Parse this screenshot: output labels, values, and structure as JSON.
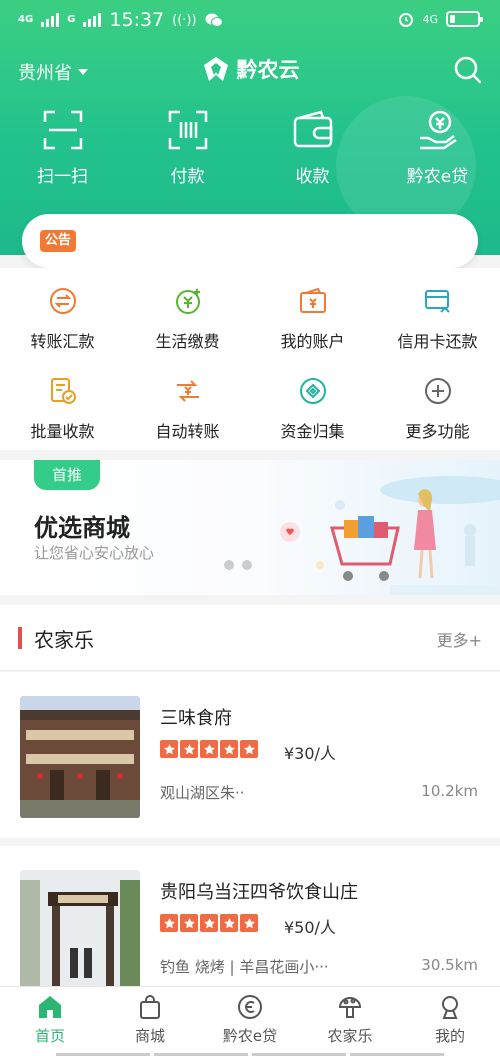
{
  "status_bar": {
    "time": "15:37",
    "network_left": "4G",
    "network_left2": "G",
    "network_right": "4G",
    "battery_level": 0.2
  },
  "header": {
    "province": "贵州省",
    "app_name": "黔农云"
  },
  "quick_actions": [
    {
      "label": "扫一扫",
      "icon": "scan-icon"
    },
    {
      "label": "付款",
      "icon": "barcode-icon"
    },
    {
      "label": "收款",
      "icon": "wallet-icon"
    },
    {
      "label": "黔农e贷",
      "icon": "loan-hand-icon"
    }
  ],
  "notice": {
    "tag": "公告",
    "text": ""
  },
  "services": [
    {
      "label": "转账汇款",
      "icon": "transfer-icon"
    },
    {
      "label": "生活缴费",
      "icon": "bill-payment-icon"
    },
    {
      "label": "我的账户",
      "icon": "account-icon"
    },
    {
      "label": "信用卡还款",
      "icon": "credit-card-icon"
    },
    {
      "label": "批量收款",
      "icon": "batch-collect-icon"
    },
    {
      "label": "自动转账",
      "icon": "auto-transfer-icon"
    },
    {
      "label": "资金归集",
      "icon": "fund-pool-icon"
    },
    {
      "label": "更多功能",
      "icon": "plus-circle-icon"
    }
  ],
  "banner": {
    "tag": "首推",
    "title": "优选商城",
    "subtitle": "让您省心安心放心",
    "slide_count": 2
  },
  "section": {
    "title": "农家乐",
    "more": "更多+"
  },
  "listings": [
    {
      "name": "三味食府",
      "rating": 5,
      "price": "¥30/人",
      "location": "观山湖区朱··",
      "distance": "10.2km"
    },
    {
      "name": "贵阳乌当汪四爷饮食山庄",
      "rating": 5,
      "price": "¥50/人",
      "location": "钓鱼 烧烤 | 羊昌花画小···",
      "distance": "30.5km"
    }
  ],
  "bottom_nav": [
    {
      "label": "首页",
      "icon": "home-icon",
      "active": true
    },
    {
      "label": "商城",
      "icon": "shopping-bag-icon",
      "active": false
    },
    {
      "label": "黔农e贷",
      "icon": "loan-icon",
      "active": false
    },
    {
      "label": "农家乐",
      "icon": "mushroom-icon",
      "active": false
    },
    {
      "label": "我的",
      "icon": "profile-icon",
      "active": false
    }
  ],
  "colors": {
    "brand_green": "#2bb673",
    "accent_orange": "#f07a35",
    "star_red": "#f06a44",
    "section_bar": "#e05050"
  }
}
